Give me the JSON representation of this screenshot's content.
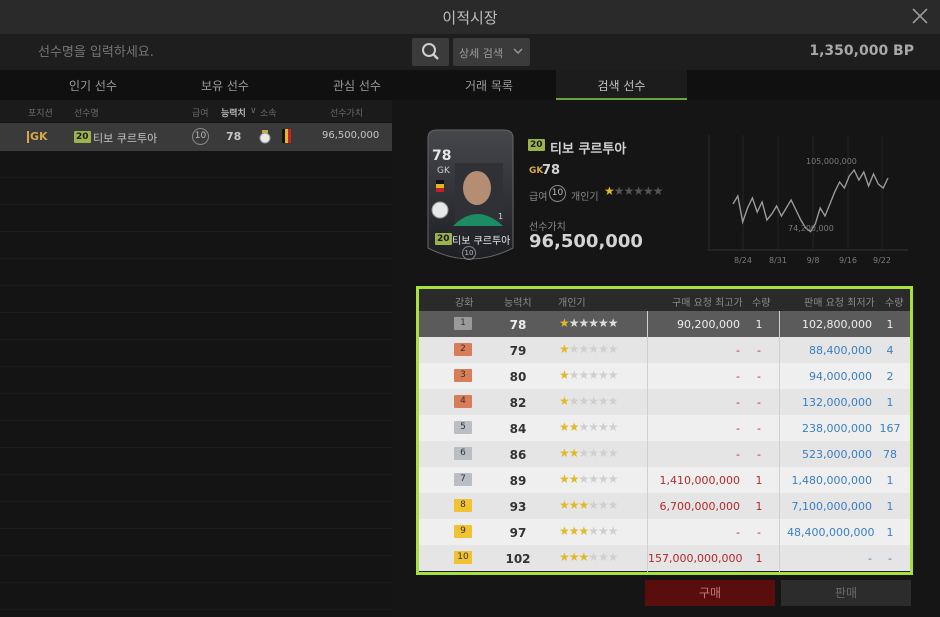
{
  "window": {
    "title": "이적시장"
  },
  "search": {
    "placeholder": "선수명을 입력하세요.",
    "detail_label": "상세 검색",
    "bp": "1,350,000 BP"
  },
  "tabs": [
    {
      "label": "인기 선수"
    },
    {
      "label": "보유 선수"
    },
    {
      "label": "관심 선수"
    },
    {
      "label": "거래 목록"
    },
    {
      "label": "검색 선수"
    }
  ],
  "list": {
    "headers": {
      "position": "포지션",
      "name": "선수명",
      "salary": "급여",
      "ovr": "능력치",
      "club": "소속",
      "value": "선수가치"
    },
    "row": {
      "position": "GK",
      "level": "20",
      "name": "티보 쿠르투아",
      "salary": "10",
      "ovr": "78",
      "value": "96,500,000"
    }
  },
  "player": {
    "card": {
      "ovr": "78",
      "position": "GK",
      "level": "20",
      "name": "티보 쿠르투아",
      "salary": "10",
      "rank": "1"
    },
    "level": "20",
    "name": "티보 쿠르투아",
    "position": "GK",
    "ovr": "78",
    "salary_label": "급여",
    "salary": "10",
    "popularity_label": "개인기",
    "popularity_stars": 1,
    "value_label": "선수가치",
    "value": "96,500,000"
  },
  "chart_data": {
    "type": "line",
    "x": [
      "8/24",
      "8/31",
      "9/8",
      "9/16",
      "9/22"
    ],
    "series": [
      {
        "values": [
          88,
          92,
          79,
          86,
          91,
          84,
          89,
          80,
          83,
          87,
          82,
          86,
          90,
          85,
          80,
          76,
          74.2,
          78,
          86,
          82,
          88,
          94,
          99,
          96,
          102,
          105,
          100,
          104,
          97,
          103,
          98,
          96,
          101
        ]
      }
    ],
    "annotations": [
      {
        "label": "105,000,000"
      },
      {
        "label": "74,200,000"
      }
    ],
    "xticks": [
      "8/24",
      "8/31",
      "9/8",
      "9/16",
      "9/22"
    ],
    "grid": true
  },
  "table": {
    "headers": {
      "grade": "강화",
      "ovr": "능력치",
      "skill": "개인기",
      "buy_max": "구매 요청 최고가",
      "buy_qty": "수량",
      "sell_min": "판매 요청 최저가",
      "sell_qty": "수량"
    },
    "rows": [
      {
        "grade": "1",
        "color": "#9a9a9a",
        "ovr": "78",
        "stars": 1,
        "buy_max": "90,200,000",
        "buy_qty": "1",
        "sell_min": "102,800,000",
        "sell_qty": "1"
      },
      {
        "grade": "2",
        "color": "#d97d59",
        "ovr": "79",
        "stars": 1,
        "buy_max": "-",
        "buy_qty": "-",
        "sell_min": "88,400,000",
        "sell_qty": "4"
      },
      {
        "grade": "3",
        "color": "#d97d59",
        "ovr": "80",
        "stars": 1,
        "buy_max": "-",
        "buy_qty": "-",
        "sell_min": "94,000,000",
        "sell_qty": "2"
      },
      {
        "grade": "4",
        "color": "#d97d59",
        "ovr": "82",
        "stars": 1,
        "buy_max": "-",
        "buy_qty": "-",
        "sell_min": "132,000,000",
        "sell_qty": "1"
      },
      {
        "grade": "5",
        "color": "#b8bec4",
        "ovr": "84",
        "stars": 2,
        "buy_max": "-",
        "buy_qty": "-",
        "sell_min": "238,000,000",
        "sell_qty": "167"
      },
      {
        "grade": "6",
        "color": "#b8bec4",
        "ovr": "86",
        "stars": 2,
        "buy_max": "-",
        "buy_qty": "-",
        "sell_min": "523,000,000",
        "sell_qty": "78"
      },
      {
        "grade": "7",
        "color": "#b8bec4",
        "ovr": "89",
        "stars": 2,
        "buy_max": "1,410,000,000",
        "buy_qty": "1",
        "sell_min": "1,480,000,000",
        "sell_qty": "1"
      },
      {
        "grade": "8",
        "color": "#f1c232",
        "ovr": "93",
        "stars": 3,
        "buy_max": "6,700,000,000",
        "buy_qty": "1",
        "sell_min": "7,100,000,000",
        "sell_qty": "1"
      },
      {
        "grade": "9",
        "color": "#f1c232",
        "ovr": "97",
        "stars": 3,
        "buy_max": "-",
        "buy_qty": "-",
        "sell_min": "48,400,000,000",
        "sell_qty": "1"
      },
      {
        "grade": "10",
        "color": "#f1c232",
        "ovr": "102",
        "stars": 3,
        "buy_max": "157,000,000,000",
        "buy_qty": "1",
        "sell_min": "-",
        "sell_qty": "-"
      }
    ]
  },
  "actions": {
    "buy_label": "구매",
    "sell_label": "판매"
  }
}
